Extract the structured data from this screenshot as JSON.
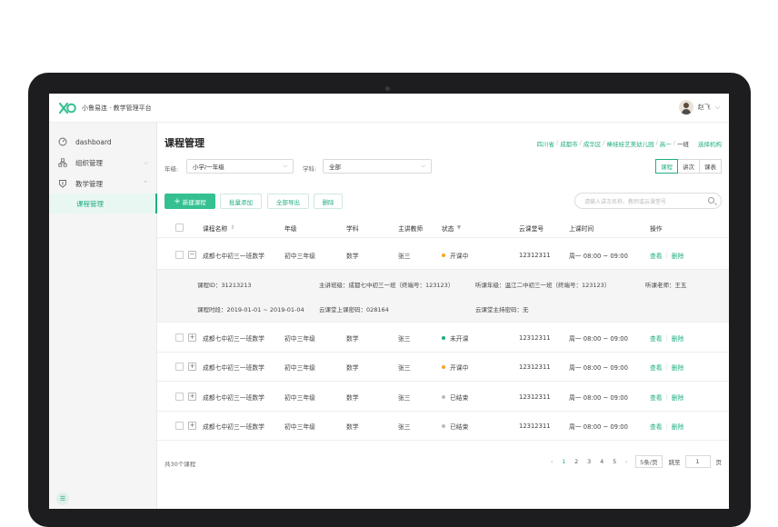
{
  "app": {
    "title": "小鲁易连 · 教学管理平台",
    "user_name": "赵飞"
  },
  "sidebar": {
    "items": [
      {
        "label": "dashboard",
        "icon": "dashboard-icon"
      },
      {
        "label": "组织管理",
        "icon": "org-icon"
      },
      {
        "label": "教学管理",
        "icon": "teaching-icon"
      }
    ],
    "sub_item": "课程管理",
    "footer_icon": "collapse-icon"
  },
  "page": {
    "title": "课程管理",
    "breadcrumb": [
      "四川省",
      "成都市",
      "成华区",
      "棒娃娃艺美幼儿园",
      "高一"
    ],
    "breadcrumb_current": "一班",
    "choose_org": "选择机构"
  },
  "filters": {
    "grade_label": "年级:",
    "grade_value": "小学/一年级",
    "subject_label": "学科:",
    "subject_value": "全部"
  },
  "view_tabs": [
    "课程",
    "讲次",
    "课表"
  ],
  "toolbar": {
    "new": "新建课程",
    "batch_add": "批量添加",
    "export_all": "全部导出",
    "delete": "删除",
    "search_placeholder": "请输入讲次名称、教师或云课堂号"
  },
  "table": {
    "headers": [
      "课程名称",
      "年级",
      "学科",
      "主讲教师",
      "状态",
      "云课堂号",
      "上课时间",
      "操作"
    ],
    "actions": {
      "view": "查看",
      "delete": "删除"
    },
    "rows": [
      {
        "name": "成都七中初三一班数学",
        "grade": "初中三年级",
        "subject": "数学",
        "teacher": "张三",
        "status": "开课中",
        "status_color": "#f5a623",
        "cloud": "12312311",
        "time": "周一 08:00 ~ 09:00",
        "expanded": true
      },
      {
        "name": "成都七中初三一班数学",
        "grade": "初中三年级",
        "subject": "数学",
        "teacher": "张三",
        "status": "未开课",
        "status_color": "#1fae84",
        "cloud": "12312311",
        "time": "周一 08:00 ~ 09:00",
        "expanded": false
      },
      {
        "name": "成都七中初三一班数学",
        "grade": "初中三年级",
        "subject": "数学",
        "teacher": "张三",
        "status": "开课中",
        "status_color": "#f5a623",
        "cloud": "12312311",
        "time": "周一 08:00 ~ 09:00",
        "expanded": false
      },
      {
        "name": "成都七中初三一班数学",
        "grade": "初中三年级",
        "subject": "数学",
        "teacher": "张三",
        "status": "已结束",
        "status_color": "#bbbbbb",
        "cloud": "12312311",
        "time": "周一 08:00 ~ 09:00",
        "expanded": false
      },
      {
        "name": "成都七中初三一班数学",
        "grade": "初中三年级",
        "subject": "数学",
        "teacher": "张三",
        "status": "已结束",
        "status_color": "#bbbbbb",
        "cloud": "12312311",
        "time": "周一 08:00 ~ 09:00",
        "expanded": false
      }
    ]
  },
  "detail": {
    "course_id": "课程ID：31213213",
    "main_class": "主讲班级：成都七中初三一班（终端号：123123）",
    "listen_class": "听课年级：温江二中初三一班（终端号：123123）",
    "listen_teacher": "听课老师：王五",
    "period": "课程时段：2019-01-01 ~ 2019-01-04",
    "password": "云课堂上课密码：028164",
    "host_password": "云课堂主持密码：无"
  },
  "footer": {
    "total": "共30个课程",
    "pages": [
      "1",
      "2",
      "3",
      "4",
      "5"
    ],
    "active_page": "1",
    "page_size": "5条/页",
    "goto_label": "跳至",
    "goto_value": "1",
    "page_unit": "页"
  },
  "colors": {
    "accent": "#1fae84",
    "primary_button": "#35c092"
  }
}
